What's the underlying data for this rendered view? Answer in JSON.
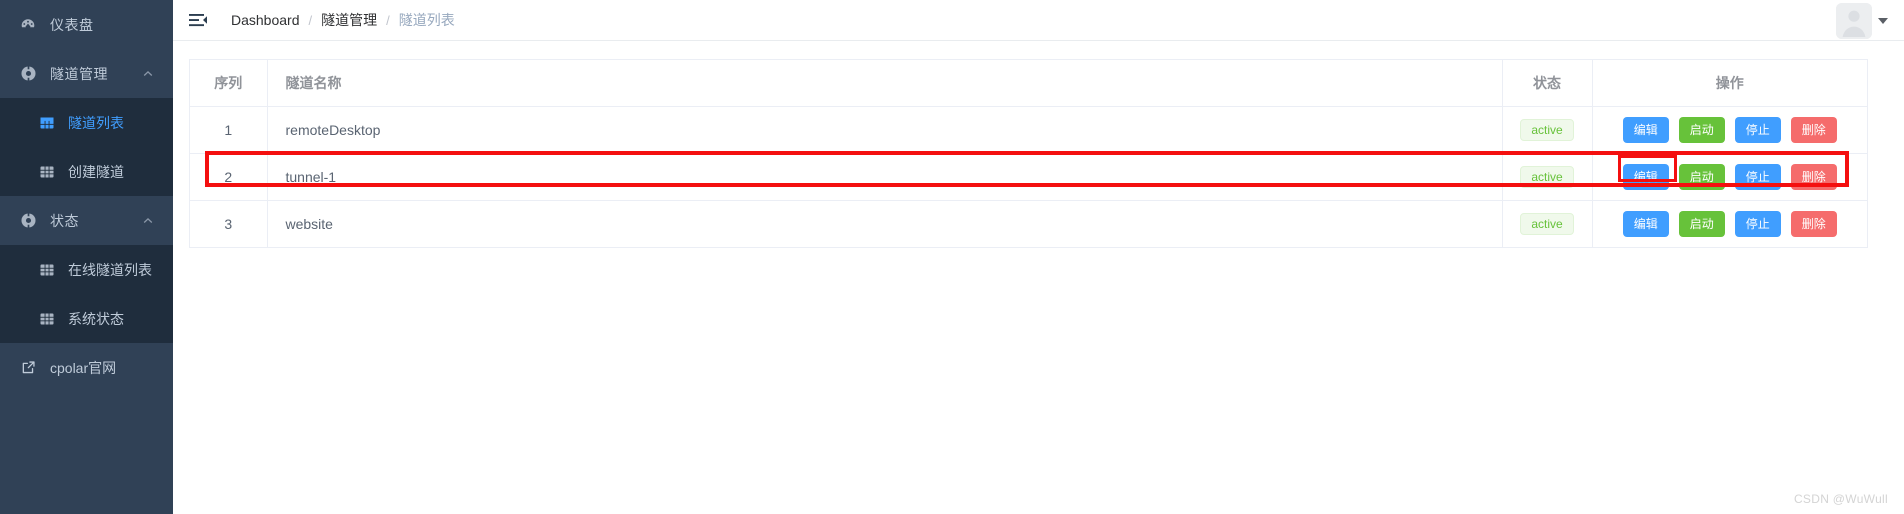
{
  "sidebar": {
    "items": [
      {
        "label": "仪表盘",
        "icon": "dashboard-icon",
        "type": "link"
      },
      {
        "label": "隧道管理",
        "icon": "tunnel-icon",
        "type": "group",
        "arrow": "chevron-up-icon",
        "expanded": true
      },
      {
        "label": "隧道列表",
        "icon": "table-icon",
        "type": "sub",
        "active": true
      },
      {
        "label": "创建隧道",
        "icon": "table-icon",
        "type": "sub",
        "active": false
      },
      {
        "label": "状态",
        "icon": "status-icon",
        "type": "group",
        "arrow": "chevron-up-icon",
        "expanded": true
      },
      {
        "label": "在线隧道列表",
        "icon": "table-icon",
        "type": "sub",
        "active": false
      },
      {
        "label": "系统状态",
        "icon": "table-icon",
        "type": "sub",
        "active": false
      },
      {
        "label": "cpolar官网",
        "icon": "external-link-icon",
        "type": "external"
      }
    ]
  },
  "navbar": {
    "hamburger_icon": "hamburger-collapse-icon",
    "breadcrumb": [
      {
        "label": "Dashboard",
        "current": false
      },
      {
        "label": "隧道管理",
        "current": false
      },
      {
        "label": "隧道列表",
        "current": true
      }
    ],
    "separator": "/",
    "avatar_icon": "user-avatar-icon",
    "caret_icon": "caret-down-icon"
  },
  "table": {
    "columns": [
      {
        "key": "index",
        "label": "序列"
      },
      {
        "key": "name",
        "label": "隧道名称"
      },
      {
        "key": "status",
        "label": "状态"
      },
      {
        "key": "ops",
        "label": "操作"
      }
    ],
    "rows": [
      {
        "index": "1",
        "name": "remoteDesktop",
        "status": "active",
        "highlighted": false
      },
      {
        "index": "2",
        "name": "tunnel-1",
        "status": "active",
        "highlighted": true
      },
      {
        "index": "3",
        "name": "website",
        "status": "active",
        "highlighted": false
      }
    ],
    "actions": [
      {
        "label": "编辑",
        "style": "primary"
      },
      {
        "label": "启动",
        "style": "success"
      },
      {
        "label": "停止",
        "style": "info"
      },
      {
        "label": "删除",
        "style": "danger"
      }
    ]
  },
  "annotations": {
    "row_highlight_label": "tunnel-1 row highlight",
    "edit_button_highlight_label": "编辑 button highlight",
    "color": "#f40f0f"
  },
  "watermark": {
    "text": "CSDN @WuWull"
  },
  "colors": {
    "sidebar_bg": "#304156",
    "submenu_bg": "#1f2d3d",
    "accent": "#409eff",
    "success": "#67c23a",
    "danger": "#f56c6c",
    "badge_bg": "#f0f9eb",
    "badge_text": "#67c23a"
  }
}
